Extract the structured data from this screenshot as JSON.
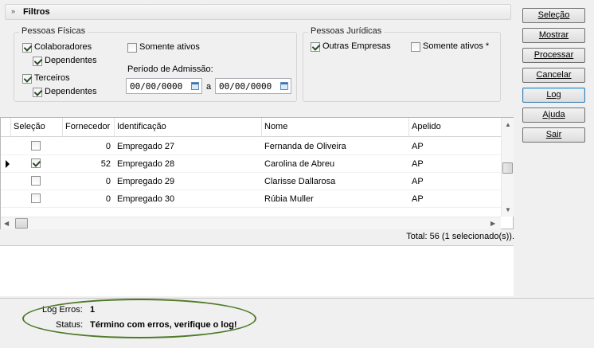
{
  "filters": {
    "toggle_glyph": "»",
    "title": "Filtros",
    "pessoas_fisicas": {
      "title": "Pessoas Físicas",
      "colaboradores": {
        "label": "Colaboradores",
        "checked": true
      },
      "colaboradores_dependentes": {
        "label": "Dependentes",
        "checked": true
      },
      "terceiros": {
        "label": "Terceiros",
        "checked": true
      },
      "terceiros_dependentes": {
        "label": "Dependentes",
        "checked": true
      },
      "somente_ativos": {
        "label": "Somente ativos",
        "checked": false
      },
      "periodo_label": "Período de Admissão:",
      "date_from": "00/00/0000",
      "date_sep": "a",
      "date_to": "00/00/0000"
    },
    "pessoas_juridicas": {
      "title": "Pessoas Jurídicas",
      "outras_empresas": {
        "label": "Outras Empresas",
        "checked": true
      },
      "somente_ativos": {
        "label": "Somente ativos *",
        "checked": false
      }
    }
  },
  "buttons": {
    "selecao": "Seleção",
    "mostrar": "Mostrar",
    "processar": "Processar",
    "cancelar": "Cancelar",
    "log": "Log",
    "ajuda": "Ajuda",
    "sair": "Sair"
  },
  "grid": {
    "columns": [
      "Seleção",
      "Fornecedor",
      "Identificação",
      "Nome",
      "Apelido"
    ],
    "rows": [
      {
        "selected": false,
        "current": false,
        "fornecedor": "0",
        "identificacao": "Empregado 27",
        "nome": "Fernanda de Oliveira",
        "apelido": "AP"
      },
      {
        "selected": true,
        "current": true,
        "fornecedor": "52",
        "identificacao": "Empregado 28",
        "nome": "Carolina de Abreu",
        "apelido": "AP"
      },
      {
        "selected": false,
        "current": false,
        "fornecedor": "0",
        "identificacao": "Empregado 29",
        "nome": "Clarisse Dallarosa",
        "apelido": "AP"
      },
      {
        "selected": false,
        "current": false,
        "fornecedor": "0",
        "identificacao": "Empregado 30",
        "nome": "Rúbia Muller",
        "apelido": "AP"
      }
    ],
    "total": "Total: 56 (1 selecionado(s))."
  },
  "status": {
    "log_label": "Log Erros:",
    "log_value": "1",
    "status_label": "Status:",
    "status_value": "Término com erros, verifique o log!"
  },
  "colors": {
    "annotation_ellipse": "#4f7a28",
    "focus_border": "#3c7fb1"
  }
}
